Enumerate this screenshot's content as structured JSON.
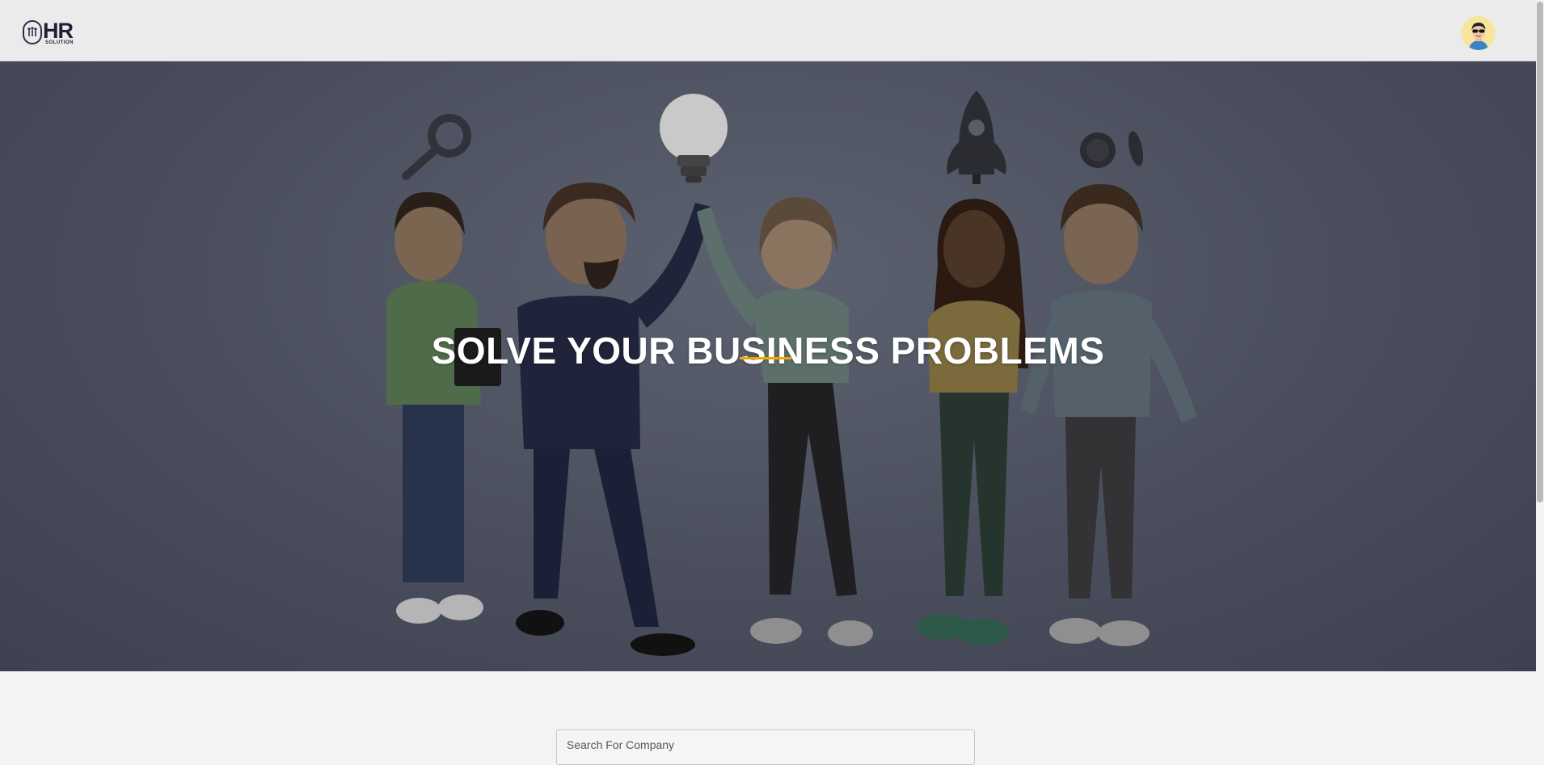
{
  "navbar": {
    "logo_text": "HR",
    "logo_subtext": "SOLUTION"
  },
  "hero": {
    "title": "SOLVE YOUR BUSINESS PROBLEMS"
  },
  "search": {
    "placeholder": "Search For Company"
  },
  "colors": {
    "accent": "#f0a500",
    "navbar_bg": "#ebebeb",
    "hero_overlay": "#4a4e5c",
    "logo_dark": "#1f2035"
  }
}
